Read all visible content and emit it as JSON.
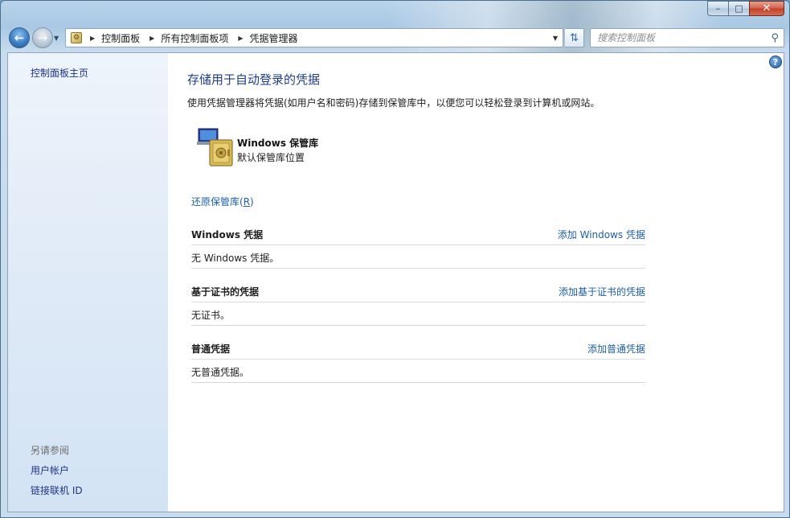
{
  "window": {
    "caption": {
      "minimize": "–",
      "maximize": "□",
      "close": "✕"
    }
  },
  "nav": {
    "back_icon": "back-arrow-icon",
    "forward_icon": "forward-arrow-icon",
    "breadcrumbs": [
      "控制面板",
      "所有控制面板项",
      "凭据管理器"
    ],
    "search_placeholder": "搜索控制面板"
  },
  "sidebar": {
    "home": "控制面板主页",
    "see_also_title": "另请参阅",
    "links": [
      "用户帐户",
      "链接联机 ID"
    ]
  },
  "main": {
    "title": "存储用于自动登录的凭据",
    "description": "使用凭据管理器将凭据(如用户名和密码)存储到保管库中，以便您可以轻松登录到计算机或网站。",
    "vault": {
      "name": "Windows 保管库",
      "subtitle": "默认保管库位置"
    },
    "restore_link": {
      "text": "还原保管库",
      "shortcut_prefix": "(",
      "shortcut_key": "R",
      "shortcut_suffix": ")"
    },
    "sections": [
      {
        "title": "Windows 凭据",
        "action": "添加 Windows 凭据",
        "empty_text": "无 Windows 凭据。"
      },
      {
        "title": "基于证书的凭据",
        "action": "添加基于证书的凭据",
        "empty_text": "无证书。"
      },
      {
        "title": "普通凭据",
        "action": "添加普通凭据",
        "empty_text": "无普通凭据。"
      }
    ]
  },
  "colors": {
    "link": "#1e5ea8",
    "title": "#1e3d8f",
    "sidebar_link": "#1e3287"
  }
}
